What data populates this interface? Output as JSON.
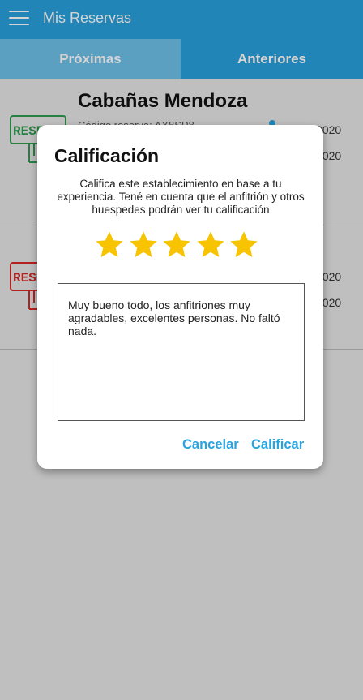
{
  "appbar": {
    "title": "Mis Reservas",
    "menu_icon": "hamburger-menu-icon"
  },
  "tabs": [
    {
      "label": "Próximas",
      "selected": true
    },
    {
      "label": "Anteriores",
      "selected": false
    }
  ],
  "cards": [
    {
      "title": "Cabañas Mendoza",
      "code": "Código reserva: AX8SP8",
      "date1": "2020",
      "date2": "2020",
      "icon_color": "#2e9b4f",
      "icon": "reserva-sign-icon"
    },
    {
      "date1": "2020",
      "date2": "2020",
      "icon_color": "#d72a2a",
      "icon": "reserva-sign-icon"
    }
  ],
  "dialog": {
    "title": "Calificación",
    "text": "Califica este establecimiento en base a tu experiencia. Tené en cuenta que el anfitrión y otros huespedes podrán ver tu calificación",
    "rating": 5,
    "max_rating": 5,
    "star_color": "#f8c300",
    "comment": "Muy bueno todo, los anfitriones muy agradables, excelentes personas. No faltó nada.",
    "cancel_label": "Cancelar",
    "submit_label": "Calificar"
  },
  "colors": {
    "primary": "#2aa0dc",
    "tab_selected": "#6ec0e9",
    "accent": "#29a4e0"
  }
}
